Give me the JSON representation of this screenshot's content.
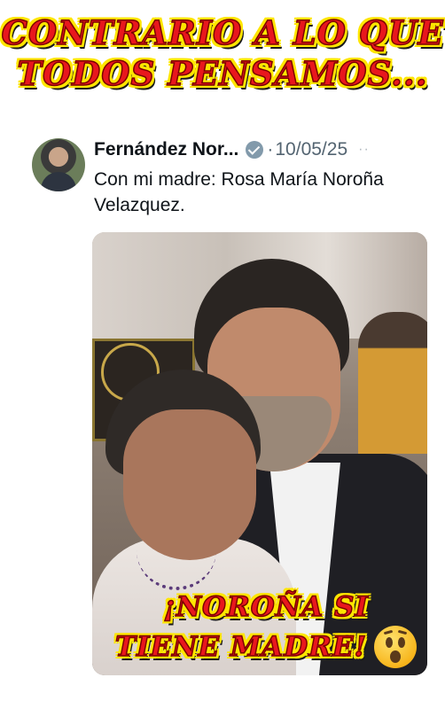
{
  "meme": {
    "top_caption": [
      "Contrario a lo que",
      "todos pensamos..."
    ],
    "bottom_caption_line1": "¡Noroña si",
    "bottom_caption_line2": "tiene madre!",
    "caption_color": "#e8171d",
    "caption_outline_color": "#ffe600",
    "emoji": "astonished-face-icon"
  },
  "tweet": {
    "author_name": "Fernández Nor...",
    "verified_badge": "verified-icon",
    "separator": "·",
    "date": "10/05/25",
    "more_menu": "··",
    "text": "Con mi madre: Rosa María Noroña Velazquez."
  },
  "photo": {
    "description_icon": "photo-mother-and-son"
  }
}
